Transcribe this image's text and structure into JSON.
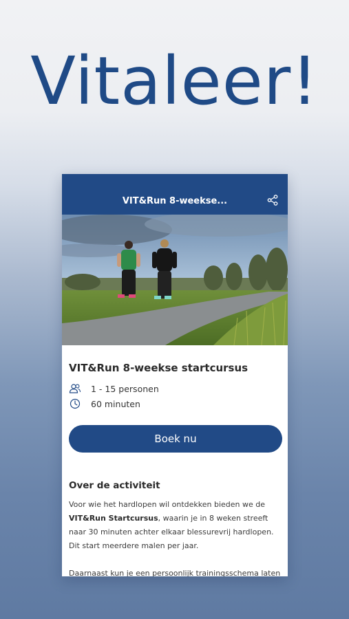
{
  "promo": {
    "title": "Vitaleer!"
  },
  "header": {
    "title": "VIT&Run 8-weekse...",
    "share_icon": "share-icon"
  },
  "photo": {
    "description_icon": "runners-photo"
  },
  "activity": {
    "title": "VIT&Run 8-weekse startcursus",
    "participants": "1 - 15 personen",
    "duration": "60 minuten",
    "book_label": "Boek nu"
  },
  "about": {
    "heading": "Over de activiteit",
    "p1_before": "Voor wie het hardlopen wil ontdekken bieden we de ",
    "p1_bold": "VIT&Run Startcursus",
    "p1_after": ", waarin je in 8 weken streeft naar 30 minuten achter elkaar blessurevrij hardlopen. Dit start meerdere malen per jaar.",
    "p2": "Daarnaast kun je een persoonlijk trainingsschema laten"
  },
  "colors": {
    "brand": "#214a86",
    "background_top": "#f1f2f4",
    "background_bottom": "#5f7aa2"
  }
}
